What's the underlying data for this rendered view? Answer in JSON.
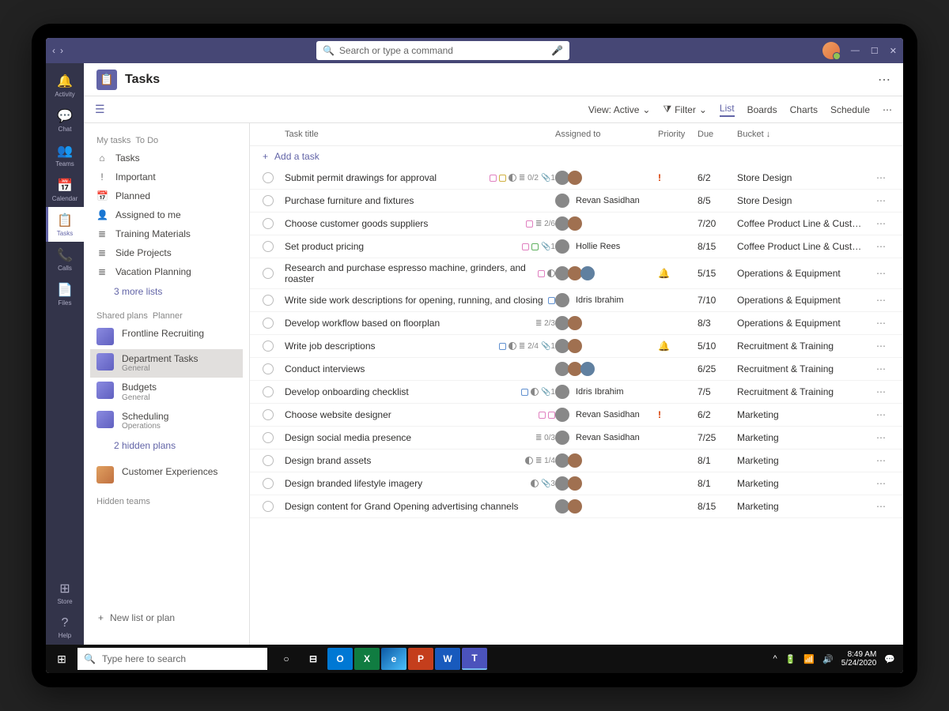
{
  "topbar": {
    "search_placeholder": "Search or type a command"
  },
  "rail": {
    "activity": "Activity",
    "chat": "Chat",
    "teams": "Teams",
    "calendar": "Calendar",
    "tasks": "Tasks",
    "calls": "Calls",
    "files": "Files",
    "store": "Store",
    "help": "Help"
  },
  "header": {
    "title": "Tasks"
  },
  "toolbar": {
    "view_label": "View: Active",
    "filter_label": "Filter",
    "tabs": {
      "list": "List",
      "boards": "Boards",
      "charts": "Charts",
      "schedule": "Schedule"
    }
  },
  "sidepanel": {
    "mytasks_header": "My tasks",
    "mytasks_sub": "To Do",
    "items": [
      {
        "icon": "⌂",
        "label": "Tasks"
      },
      {
        "icon": "!",
        "label": "Important"
      },
      {
        "icon": "📅",
        "label": "Planned"
      },
      {
        "icon": "👤",
        "label": "Assigned to me"
      },
      {
        "icon": "≣",
        "label": "Training Materials"
      },
      {
        "icon": "≣",
        "label": "Side Projects"
      },
      {
        "icon": "≣",
        "label": "Vacation Planning"
      }
    ],
    "more_lists": "3 more lists",
    "shared_header": "Shared plans",
    "shared_sub": "Planner",
    "plans": [
      {
        "name": "Frontline Recruiting",
        "sub": ""
      },
      {
        "name": "Department Tasks",
        "sub": "General",
        "selected": true
      },
      {
        "name": "Budgets",
        "sub": "General"
      },
      {
        "name": "Scheduling",
        "sub": "Operations"
      }
    ],
    "hidden_plans": "2 hidden plans",
    "customer_exp": "Customer Experiences",
    "hidden_teams": "Hidden teams",
    "new_list": "New list or plan"
  },
  "table": {
    "cols": {
      "title": "Task title",
      "assigned": "Assigned to",
      "priority": "Priority",
      "due": "Due",
      "bucket": "Bucket"
    },
    "add_task": "Add a task",
    "rows": [
      {
        "title": "Submit permit drawings for approval",
        "tags": [
          "pink",
          "yellow"
        ],
        "half": true,
        "list": "0/2",
        "clip": "1",
        "avatars": 2,
        "name": "",
        "pri": "high",
        "due": "6/2",
        "bucket": "Store Design"
      },
      {
        "title": "Purchase furniture and fixtures",
        "avatars": 1,
        "name": "Revan Sasidhan",
        "due": "8/5",
        "bucket": "Store Design"
      },
      {
        "title": "Choose customer goods suppliers",
        "tags": [
          "pink"
        ],
        "list": "2/6",
        "avatars": 2,
        "due": "7/20",
        "bucket": "Coffee Product Line & Cust…"
      },
      {
        "title": "Set product pricing",
        "tags": [
          "pink",
          "green"
        ],
        "clip": "1",
        "avatars": 1,
        "name": "Hollie Rees",
        "due": "8/15",
        "bucket": "Coffee Product Line & Cust…"
      },
      {
        "title": "Research and purchase espresso machine, grinders, and roaster",
        "tags": [
          "pink"
        ],
        "half": true,
        "avatars": 3,
        "pri": "bell",
        "due": "5/15",
        "bucket": "Operations & Equipment"
      },
      {
        "title": "Write side work descriptions for opening, running, and closing",
        "tags": [
          "blue"
        ],
        "avatars": 1,
        "name": "Idris Ibrahim",
        "due": "7/10",
        "bucket": "Operations & Equipment"
      },
      {
        "title": "Develop workflow based on floorplan",
        "list": "2/3",
        "avatars": 2,
        "due": "8/3",
        "bucket": "Operations & Equipment"
      },
      {
        "title": "Write job descriptions",
        "tags": [
          "blue"
        ],
        "half": true,
        "list": "2/4",
        "clip": "1",
        "avatars": 2,
        "pri": "bell",
        "due": "5/10",
        "bucket": "Recruitment & Training"
      },
      {
        "title": "Conduct interviews",
        "avatars": 3,
        "due": "6/25",
        "bucket": "Recruitment & Training"
      },
      {
        "title": "Develop onboarding checklist",
        "tags": [
          "blue"
        ],
        "half": true,
        "clip": "1",
        "avatars": 1,
        "name": "Idris Ibrahim",
        "due": "7/5",
        "bucket": "Recruitment & Training"
      },
      {
        "title": "Choose website designer",
        "tags": [
          "pink",
          "pink"
        ],
        "avatars": 1,
        "name": "Revan Sasidhan",
        "pri": "high",
        "due": "6/2",
        "bucket": "Marketing"
      },
      {
        "title": "Design social media presence",
        "list": "0/3",
        "avatars": 1,
        "name": "Revan Sasidhan",
        "due": "7/25",
        "bucket": "Marketing"
      },
      {
        "title": "Design brand assets",
        "half": true,
        "list": "1/4",
        "avatars": 2,
        "due": "8/1",
        "bucket": "Marketing"
      },
      {
        "title": "Design branded lifestyle imagery",
        "half": true,
        "clip": "3",
        "avatars": 2,
        "due": "8/1",
        "bucket": "Marketing"
      },
      {
        "title": "Design content for Grand Opening advertising channels",
        "avatars": 2,
        "due": "8/15",
        "bucket": "Marketing"
      }
    ]
  },
  "taskbar": {
    "search_placeholder": "Type here to search",
    "time": "8:49 AM",
    "date": "5/24/2020"
  }
}
